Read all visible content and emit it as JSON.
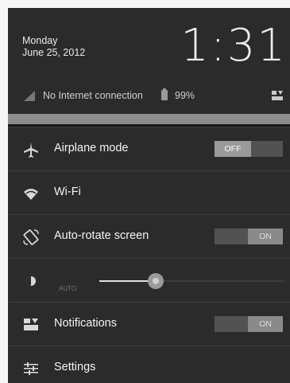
{
  "header": {
    "day": "Monday",
    "date": "June 25, 2012",
    "time": "1:31"
  },
  "status": {
    "network_text": "No Internet connection",
    "battery_text": "99%"
  },
  "quick_settings": [
    {
      "label": "Airplane mode",
      "icon": "airplane-icon",
      "toggle": "OFF"
    },
    {
      "label": "Wi-Fi",
      "icon": "wifi-icon"
    },
    {
      "label": "Auto-rotate screen",
      "icon": "rotate-icon",
      "toggle": "ON"
    },
    {
      "label": "",
      "icon": "brightness-icon",
      "auto_text": "AUTO"
    },
    {
      "label": "Notifications",
      "icon": "notifications-icon",
      "toggle": "ON"
    },
    {
      "label": "Settings",
      "icon": "settings-sliders-icon"
    }
  ],
  "colors": {
    "panel_bg": "#2b2b2b",
    "row_border": "#3c3c3c"
  }
}
